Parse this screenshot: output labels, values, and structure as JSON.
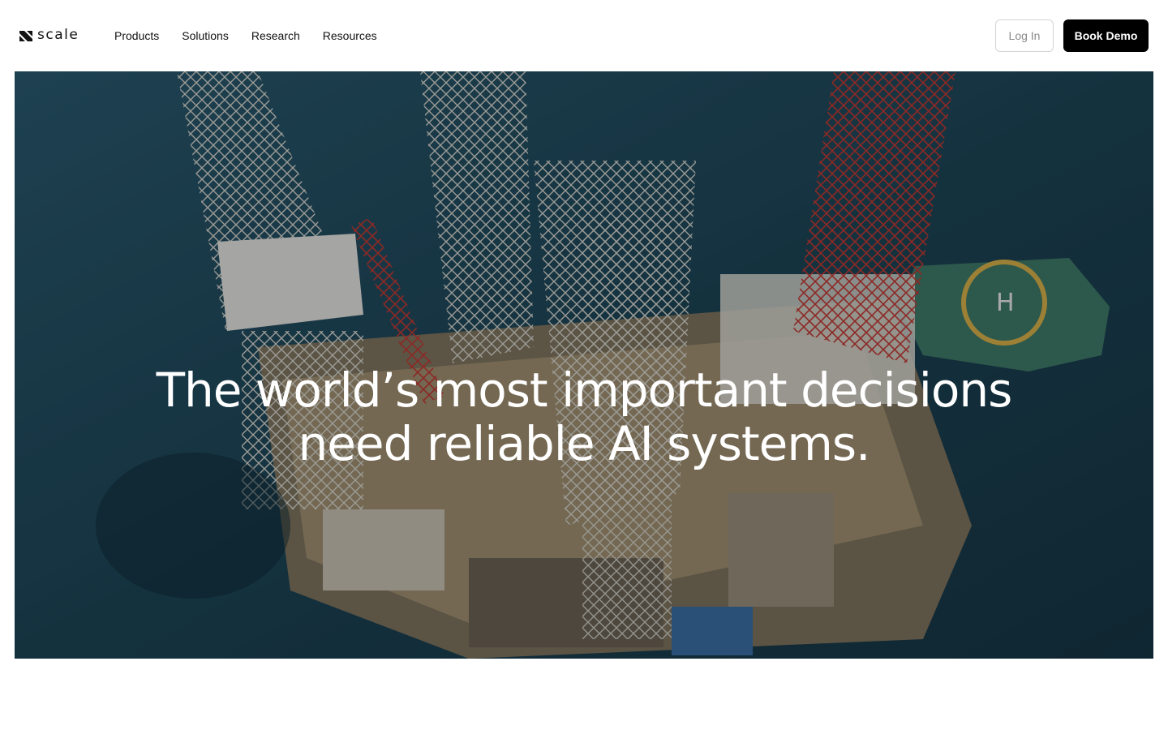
{
  "brand": {
    "name": "scale"
  },
  "nav": {
    "items": [
      "Products",
      "Solutions",
      "Research",
      "Resources"
    ]
  },
  "actions": {
    "login_label": "Log In",
    "demo_label": "Book Demo"
  },
  "hero": {
    "headline_line1": "The world’s most important decisions",
    "headline_line2": "need reliable AI systems.",
    "image_subject": "aerial view of offshore oil rig at sea",
    "colors": {
      "sea": "#1f4a5e",
      "helipad": "#3f7a6a",
      "red_tower": "#b52a2a"
    }
  }
}
